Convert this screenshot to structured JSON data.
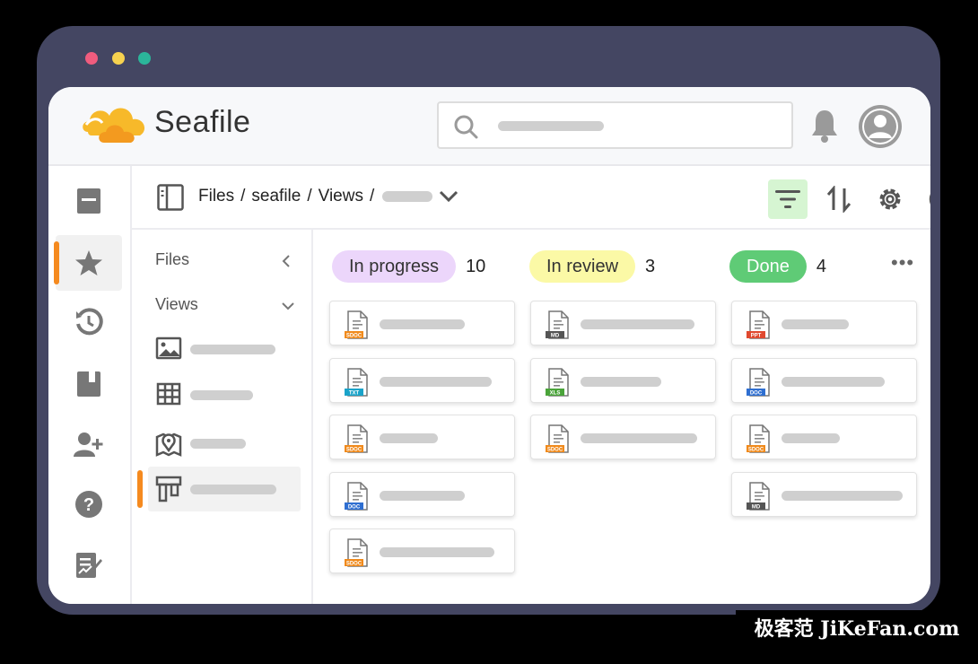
{
  "window": {
    "dots": [
      "#f05c7e",
      "#f7d24f",
      "#2bb59a"
    ]
  },
  "header": {
    "brand": "Seafile",
    "logo_icon": "seafile-cloud-logo",
    "search_icon": "search-icon",
    "bell_icon": "bell-icon",
    "avatar_icon": "user-avatar-icon"
  },
  "left_nav": {
    "items": [
      "files-icon",
      "star-icon",
      "history-icon",
      "archive-icon",
      "add-user-icon",
      "help-icon",
      "notes-icon"
    ],
    "active_index": 1,
    "accent": "#f58a1f"
  },
  "path": {
    "segments": [
      "Files",
      "/",
      "seafile",
      "/",
      "Views",
      "/"
    ],
    "toggle_icon": "sidebar-toggle-icon"
  },
  "toolbar": {
    "filter_icon": "filter-icon",
    "sort_icon": "sort-icon",
    "settings_icon": "settings-icon",
    "info_icon": "info-icon",
    "filter_active_bg": "#d6f5d2"
  },
  "sidebar": {
    "files_label": "Files",
    "views_label": "Views",
    "views": [
      "gallery-view-icon",
      "table-view-icon",
      "map-view-icon",
      "kanban-view-icon"
    ],
    "active_view": 3
  },
  "board": {
    "columns": [
      {
        "label": "In progress",
        "count": "10",
        "color": "#ecd6fb",
        "cards": [
          "SDOC",
          "TXT",
          "SDOC",
          "DOC",
          "SDOC"
        ]
      },
      {
        "label": "In review",
        "count": "3",
        "color": "#fbf9a6",
        "cards": [
          "MD",
          "XLS",
          "SDOC"
        ]
      },
      {
        "label": "Done",
        "count": "4",
        "color": "#5fcb76",
        "cards": [
          "PPT",
          "DOC",
          "SDOC",
          "MD"
        ]
      }
    ],
    "more": "•••"
  },
  "watermark": "极客范 JiKeFan.com"
}
